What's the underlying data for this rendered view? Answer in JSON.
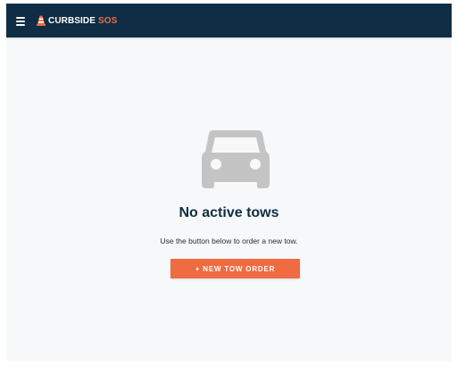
{
  "header": {
    "menu_icon": "hamburger-menu-icon",
    "logo_icon": "traffic-cone-icon",
    "brand_main": "CURBSIDE",
    "brand_accent": "SOS"
  },
  "empty_state": {
    "icon": "car-icon",
    "title": "No active tows",
    "subtitle": "Use the button below to order a new tow.",
    "button_label": "+ NEW TOW ORDER"
  },
  "colors": {
    "header_background": "#0f2d44",
    "accent": "#ef6b42",
    "page_background": "#f7f8fa",
    "icon_gray": "#c4c4c4",
    "title_text": "#0f2d44"
  }
}
